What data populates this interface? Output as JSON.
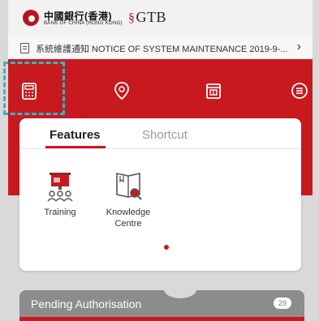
{
  "header": {
    "bank_name_cn": "中國銀行(香港)",
    "bank_name_en": "BANK OF CHINA (HONG KONG)",
    "gtb_logo": "GTB"
  },
  "notice": {
    "text": "系統維護通知 NOTICE OF SYSTEM MAINTENANCE 2019-9-...",
    "icon": "notice-icon",
    "chevron": "›"
  },
  "top_nav": [
    {
      "icon": "calculator-icon"
    },
    {
      "icon": "location-pin-icon"
    },
    {
      "icon": "calendar-icon"
    },
    {
      "icon": "menu-icon"
    }
  ],
  "tabs": {
    "features": "Features",
    "shortcut": "Shortcut"
  },
  "features": [
    {
      "label": "Training",
      "icon": "training-icon"
    },
    {
      "label": "Knowledge\nCentre",
      "icon": "knowledge-centre-icon"
    }
  ],
  "pending": {
    "label": "Pending Authorisation",
    "count": "29"
  },
  "colors": {
    "brand_red": "#c8191f",
    "highlight": "#2ab8c9",
    "pending_grey": "#8c8c8c"
  }
}
